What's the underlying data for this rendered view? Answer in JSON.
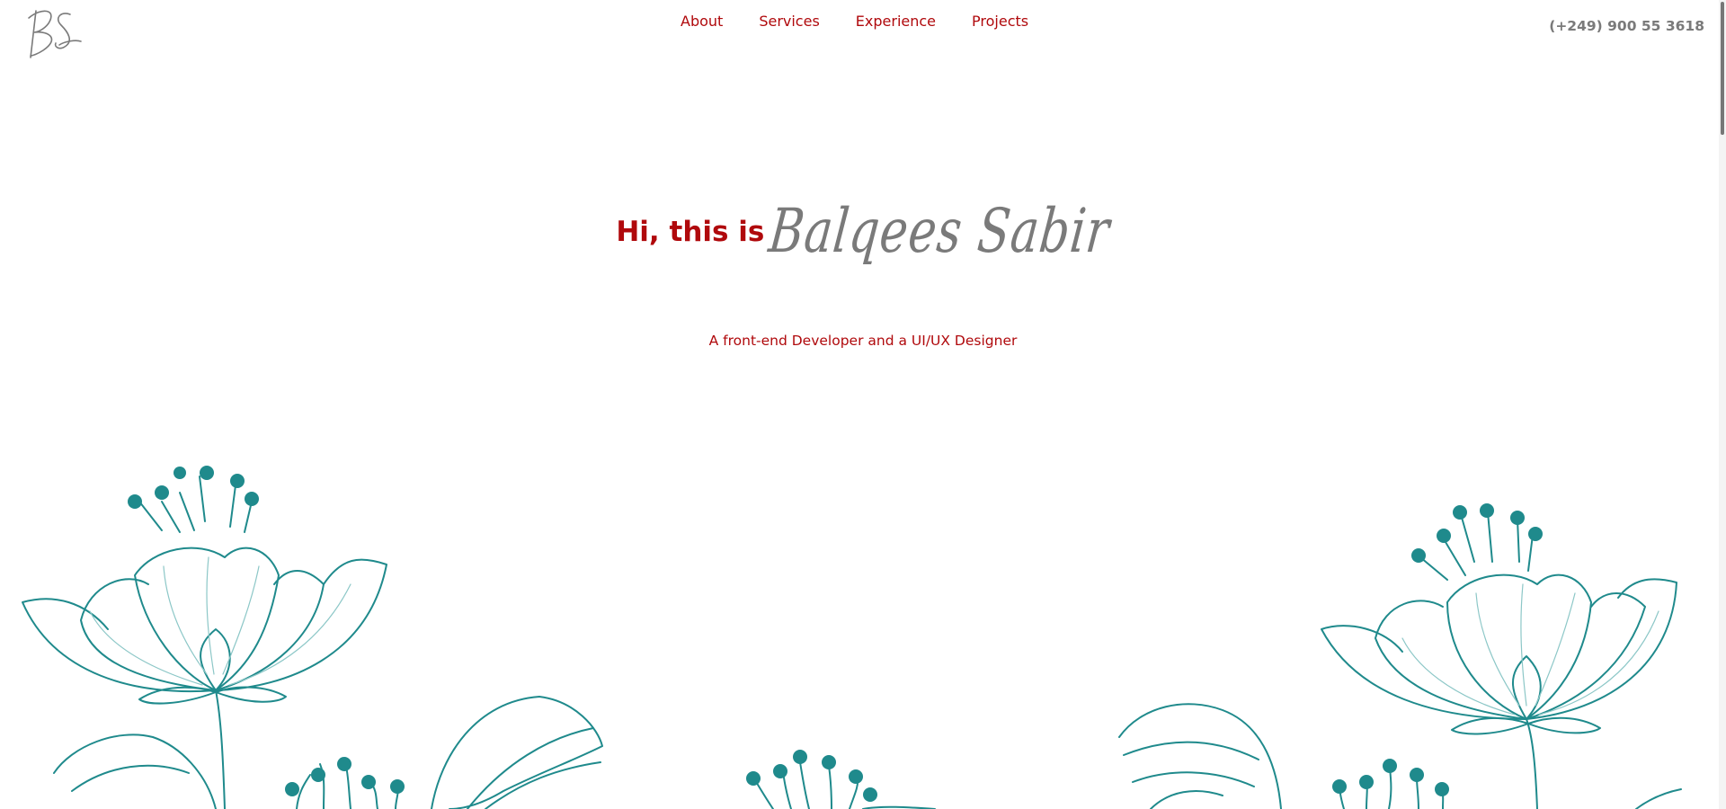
{
  "colors": {
    "accent": "#b0090c",
    "gray": "#7a7a7a",
    "teal": "#1f8a8c",
    "teal_light": "#8cc7c7"
  },
  "header": {
    "logo_icon": "bs-monogram-logo",
    "nav": [
      {
        "label": "About"
      },
      {
        "label": "Services"
      },
      {
        "label": "Experience"
      },
      {
        "label": "Projects"
      }
    ],
    "phone": "(+249) 900 55 3618"
  },
  "hero": {
    "greeting": "Hi, this is",
    "name": "Balqees Sabir",
    "tagline": "A front-end Developer and a UI/UX Designer"
  },
  "decoration": {
    "icon": "floral-line-art"
  }
}
